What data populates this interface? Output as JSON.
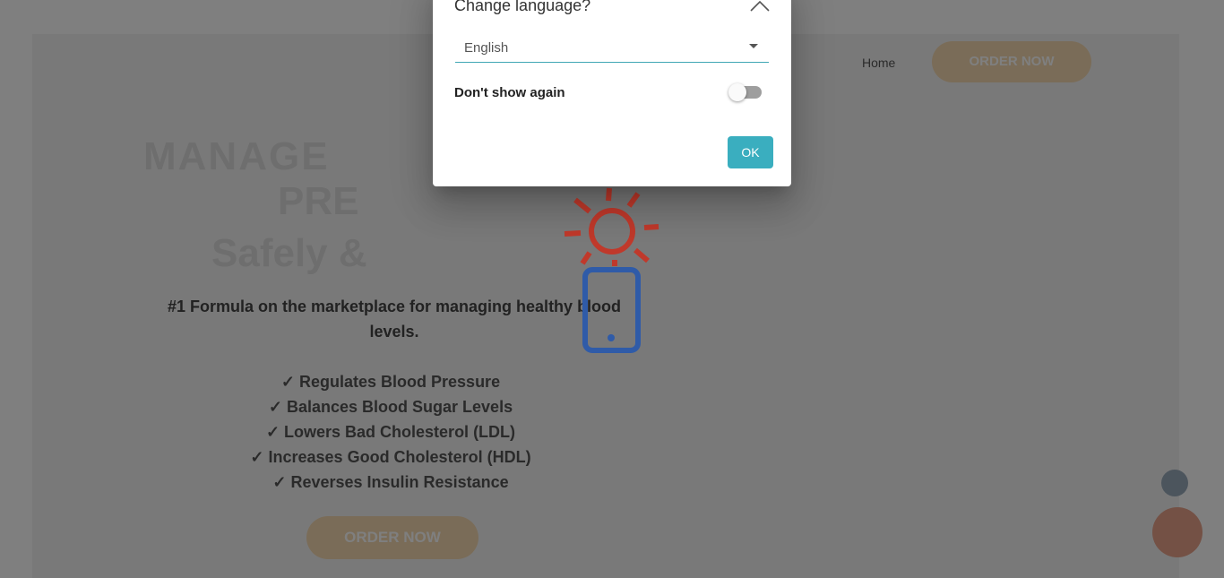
{
  "background": {
    "nav_link": "Home",
    "nav_button": "ORDER NOW",
    "hero_line1": "MANAGE",
    "hero_line2": "PRE",
    "hero_line3": "Safely &",
    "subtitle": "#1 Formula on the marketplace for managing healthy blood levels.",
    "benefits": [
      "✓ Regulates Blood Pressure",
      "✓ Balances Blood Sugar Levels",
      "✓ Lowers Bad Cholesterol (LDL)",
      "✓ Increases Good Cholesterol (HDL)",
      "✓ Reverses Insulin Resistance"
    ],
    "order_button": "ORDER NOW"
  },
  "dialog": {
    "title": "Change language?",
    "language_select": {
      "value": "English"
    },
    "dont_show_label": "Don't show again",
    "dont_show_checked": false,
    "ok_label": "OK"
  },
  "colors": {
    "accent": "#3aaebf",
    "sun_red": "#c0392b",
    "phone_blue": "#2f5ba8"
  },
  "icons": {
    "close": "close-chevron-icon",
    "dropdown": "dropdown-arrow-icon",
    "illustration": "sun-phone-icon"
  }
}
